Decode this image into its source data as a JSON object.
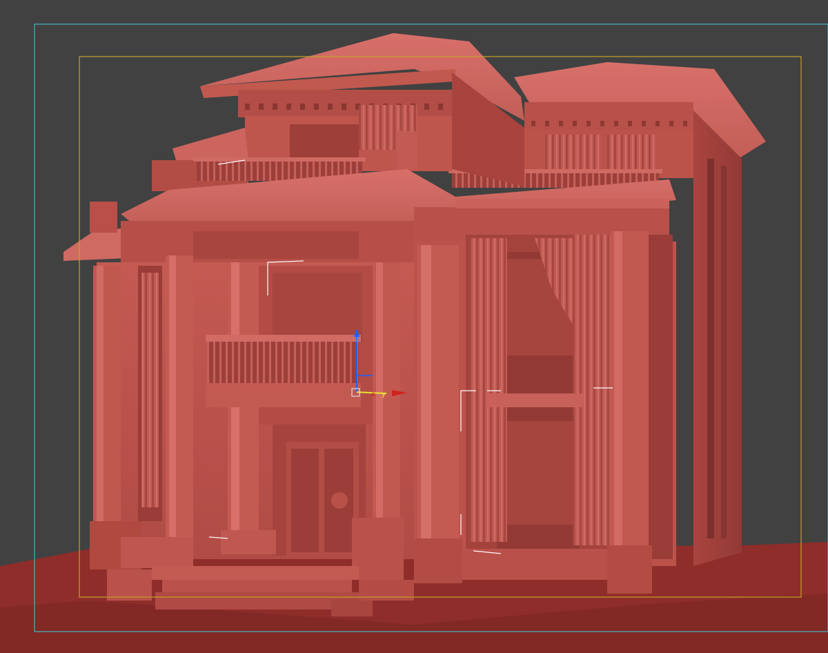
{
  "viewport": {
    "background": "#414141",
    "model_color": "#b9514b",
    "model_shadow": "#8f3a36",
    "model_highlight": "#cf6a62",
    "ground_color": "#8e2d2a",
    "safe_frame_outer_color": "#3fb7c0",
    "render_frame_color": "#c9a02a"
  },
  "gizmo": {
    "axes": [
      {
        "label": "z",
        "color": "#1e62ff"
      },
      {
        "label": "y",
        "color": "#e8e830"
      },
      {
        "label": "x",
        "color": "#d0241c"
      }
    ],
    "icon": "move-transform-gizmo-icon"
  },
  "scene": {
    "object": "classical-villa-3d-model",
    "features": [
      "hip-roof-main",
      "hip-roof-right-wing",
      "portico-with-columns",
      "balcony-balustrade",
      "arched-window-with-curtains",
      "carved-double-door",
      "entrance-steps",
      "ground-plane"
    ]
  }
}
